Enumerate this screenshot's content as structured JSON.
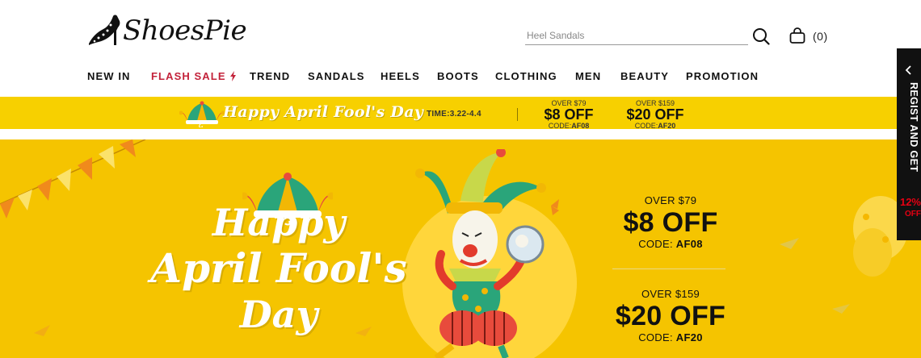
{
  "brand": {
    "name": "ShoesPie",
    "logo_icon": "high-heel-icon"
  },
  "search": {
    "placeholder": "Heel Sandals",
    "icon": "search-icon"
  },
  "cart": {
    "icon": "cart-icon",
    "count_text": "(0)"
  },
  "nav": {
    "items": [
      {
        "label": "NEW IN"
      },
      {
        "label": "FLASH SALE",
        "icon": "lightning-icon",
        "color": "#c3223a"
      },
      {
        "label": "TREND"
      },
      {
        "label": "SANDALS"
      },
      {
        "label": "HEELS"
      },
      {
        "label": "BOOTS"
      },
      {
        "label": "CLOTHING"
      },
      {
        "label": "MEN"
      },
      {
        "label": "BEAUTY"
      },
      {
        "label": "PROMOTION"
      }
    ]
  },
  "promo_strip": {
    "title": "Happy April Fool's Day",
    "time": "TIME:3.22-4.4",
    "coupons": [
      {
        "over": "OVER $79",
        "off": "$8 OFF",
        "code_prefix": "CODE:",
        "code": "AF08"
      },
      {
        "over": "OVER $159",
        "off": "$20 OFF",
        "code_prefix": "CODE:",
        "code": "AF20"
      }
    ],
    "background": "#f7d000"
  },
  "hero": {
    "title_line1": "Happy",
    "title_line2": "April Fool's",
    "title_line3": "Day",
    "coupons": [
      {
        "over": "OVER $79",
        "off": "$8 OFF",
        "code_prefix": "CODE: ",
        "code": "AF08"
      },
      {
        "over": "OVER $159",
        "off": "$20 OFF",
        "code_prefix": "CODE: ",
        "code": "AF20"
      }
    ],
    "background": "#f5c400"
  },
  "side_tab": {
    "text": "REGIST AND GET",
    "percent": "12%",
    "off": "OFF",
    "icon": "chevron-left-icon"
  },
  "colors": {
    "accent": "#c3223a",
    "promo": "#e60012",
    "yellow": "#f5c400"
  }
}
